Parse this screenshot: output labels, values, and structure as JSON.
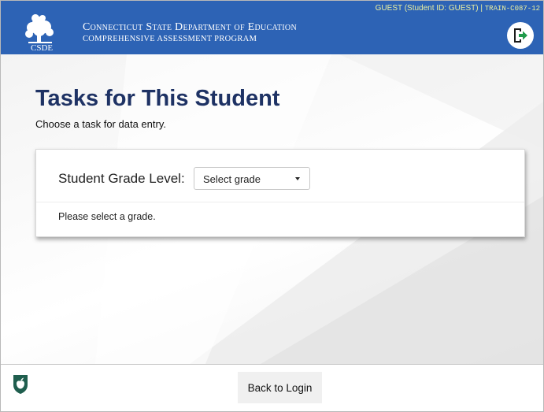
{
  "header": {
    "org_name": "Connecticut State Department of Education",
    "program_name": "COMPREHENSIVE ASSESSMENT PROGRAM",
    "logo_text": "CSDE",
    "session_user": "GUEST (Student ID: GUEST) |",
    "session_code": "TRAIN-C087-12",
    "logout_icon": "logout-arrow-icon"
  },
  "main": {
    "title": "Tasks for This Student",
    "subtitle": "Choose a task for data entry.",
    "grade": {
      "label": "Student Grade Level:",
      "selected": "Select grade",
      "message": "Please select a grade."
    }
  },
  "footer": {
    "back_button": "Back to Login",
    "shield_icon": "shield-apple-icon"
  },
  "colors": {
    "header_bg": "#2d63b5",
    "title": "#1e3264",
    "session_text": "#e9eea0",
    "footer_icon": "#1f5e4e"
  }
}
